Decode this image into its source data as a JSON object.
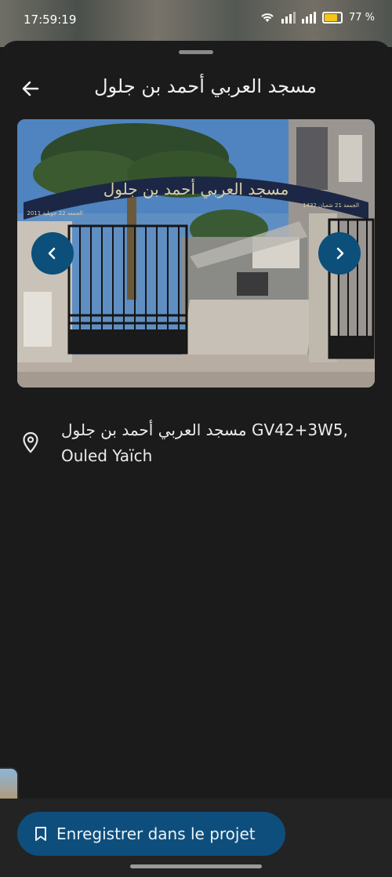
{
  "status_bar": {
    "time": "17:59:19",
    "battery_text": "77 %"
  },
  "header": {
    "title": "مسجد العربي أحمد بن جلول"
  },
  "photo": {
    "arch_text": "مسجد العربي أحمد بن جلول",
    "left_plaque": "الجمعة 22 جويلية 2011",
    "right_plaque": "الجمعة 21 شعبان 1432"
  },
  "address": {
    "line1": "مسجد العربي أحمد بن جلول GV42+3W5,",
    "line2": "Ouled Yaïch"
  },
  "actions": {
    "save_label": "Enregistrer dans le projet"
  },
  "colors": {
    "background": "#1b1b1b",
    "accent": "#0e4e7c",
    "nav_button": "#0b4f7a"
  }
}
